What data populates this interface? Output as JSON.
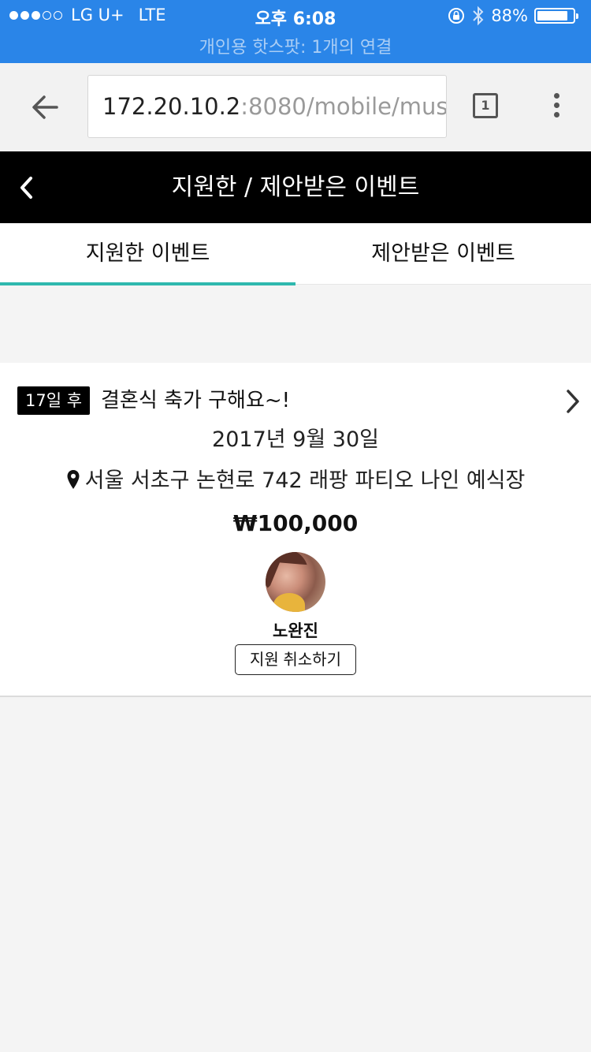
{
  "status_bar": {
    "carrier": "LG U+",
    "network": "LTE",
    "time": "오후 6:08",
    "battery_text": "88%",
    "battery_level": 0.88,
    "hotspot_text": "개인용 핫스팟: 1개의 연결"
  },
  "browser": {
    "url_host": "172.20.10.2",
    "url_rest": ":8080/mobile/mus",
    "tab_count": "1"
  },
  "page": {
    "title": "지원한 / 제안받은 이벤트"
  },
  "tabs": [
    {
      "label": "지원한 이벤트",
      "active": true
    },
    {
      "label": "제안받은 이벤트",
      "active": false
    }
  ],
  "event": {
    "badge": "17일 후",
    "title": "결혼식 축가 구해요~!",
    "date": "2017년 9월 30일",
    "location": "서울 서초구 논현로 742 래팡 파티오 나인 예식장",
    "price": "₩100,000",
    "applicant_name": "노완진",
    "cancel_label": "지원 취소하기"
  },
  "colors": {
    "status_bar": "#2a85e8",
    "tab_indicator": "#2fb8ae",
    "header_bg": "#000000"
  }
}
